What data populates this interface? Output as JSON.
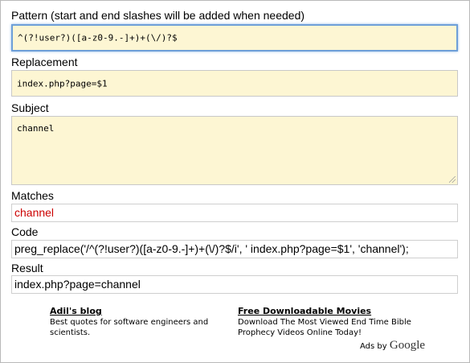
{
  "pattern": {
    "label": "Pattern (start and end slashes will be added when needed)",
    "value": "^(?!user?)([a-z0-9.-]+)+(\\/)?$"
  },
  "replacement": {
    "label": "Replacement",
    "value": "index.php?page=$1"
  },
  "subject": {
    "label": "Subject",
    "value": "channel"
  },
  "matches": {
    "label": "Matches",
    "value": "channel",
    "color": "#cc0000"
  },
  "code": {
    "label": "Code",
    "value": "preg_replace('/^(?!user?)([a-z0-9.-]+)+(\\/)?$/i', ' index.php?page=$1', 'channel');"
  },
  "result": {
    "label": "Result",
    "value": "index.php?page=channel"
  },
  "ads": {
    "items": [
      {
        "title": "Adil's blog",
        "description": "Best quotes for software engineers and scientists."
      },
      {
        "title": "Free Downloadable Movies",
        "description": "Download The Most Viewed End Time Bible Prophecy Videos Online Today!"
      }
    ],
    "ads_by_label": "Ads by",
    "ads_by_brand": "Google"
  },
  "colors": {
    "input_bg": "#fdf6d3",
    "focus_border": "#6e9fd8",
    "match_text": "#cc0000"
  }
}
